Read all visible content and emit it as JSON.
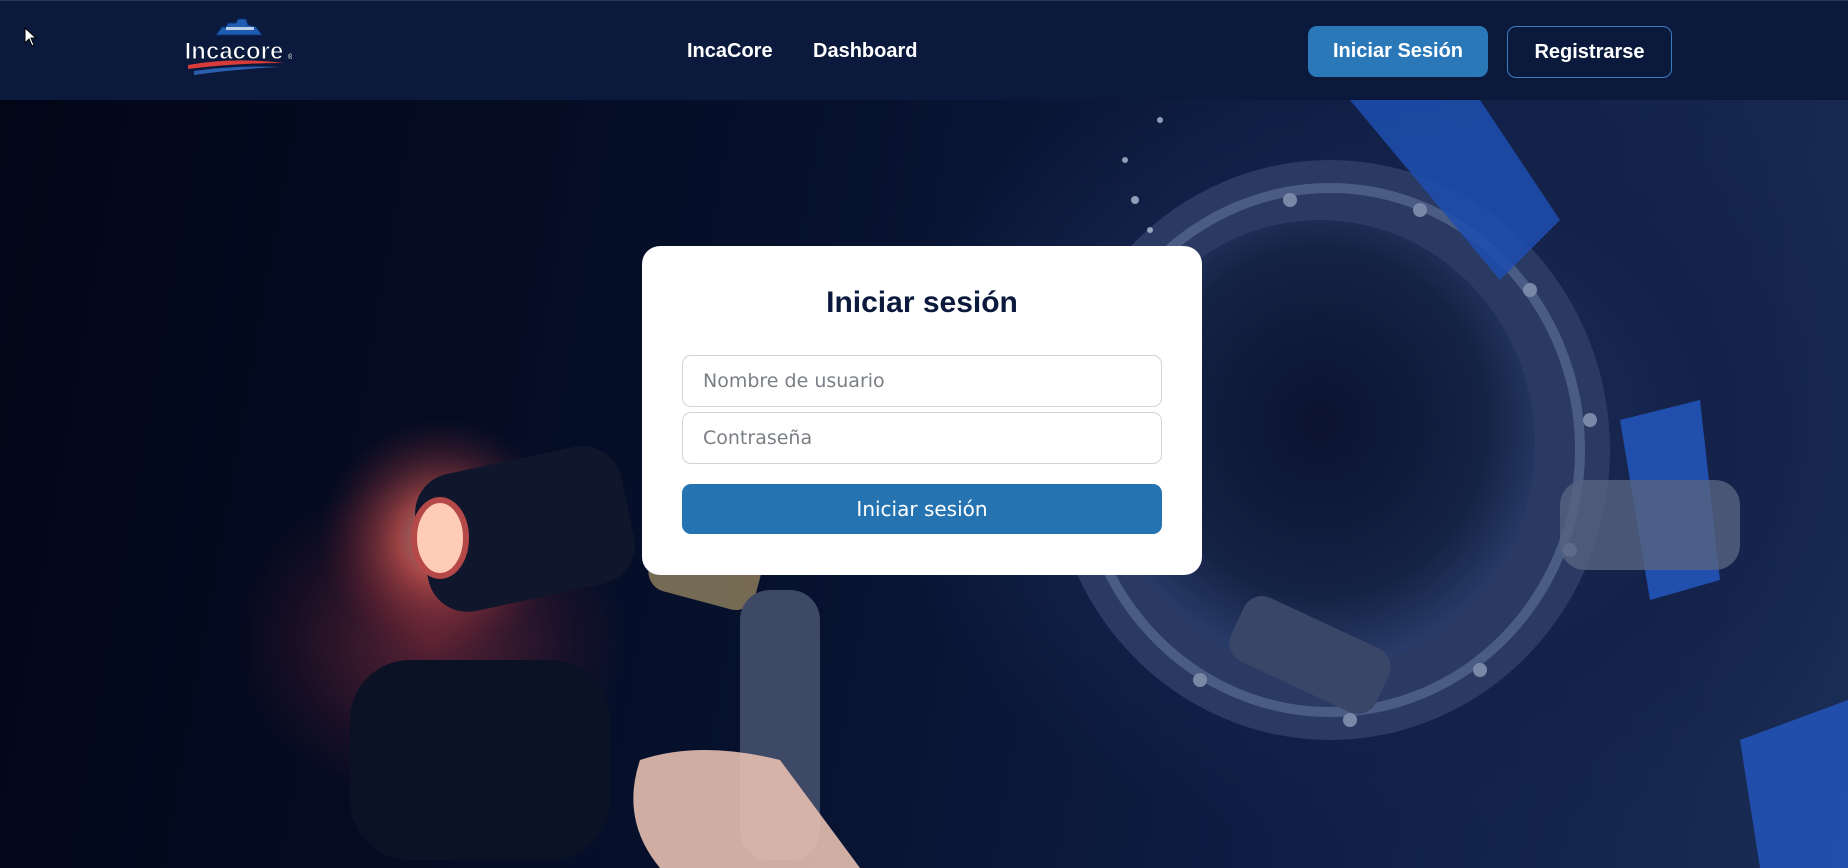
{
  "header": {
    "logo_text": "Incacore",
    "nav": [
      {
        "label": "IncaCore"
      },
      {
        "label": "Dashboard"
      }
    ],
    "login_button": "Iniciar Sesión",
    "register_button": "Registrarse"
  },
  "login_form": {
    "title": "Iniciar sesión",
    "username_placeholder": "Nombre de usuario",
    "password_placeholder": "Contraseña",
    "submit_label": "Iniciar sesión"
  },
  "colors": {
    "header_bg": "#0b1a3c",
    "primary": "#2573b0",
    "title": "#0b1a3c"
  }
}
